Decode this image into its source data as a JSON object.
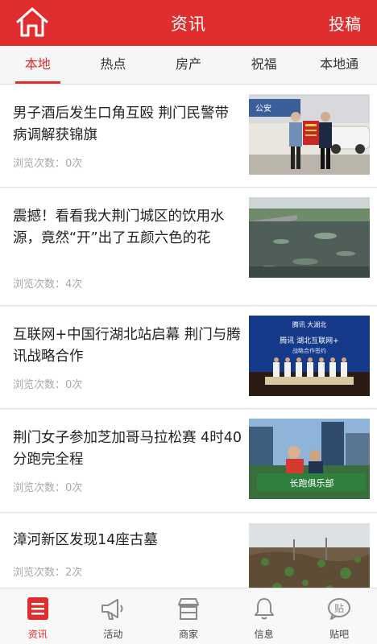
{
  "header": {
    "title": "资讯",
    "post_label": "投稿"
  },
  "tabs": [
    {
      "label": "本地",
      "active": true
    },
    {
      "label": "热点",
      "active": false
    },
    {
      "label": "房产",
      "active": false
    },
    {
      "label": "祝福",
      "active": false
    },
    {
      "label": "本地通",
      "active": false
    }
  ],
  "articles": [
    {
      "title": "男子酒后发生口角互殴 荆门民警带病调解获锦旗",
      "views": "浏览次数：0次"
    },
    {
      "title": "震撼！看看我大荆门城区的饮用水源，竟然“开”出了五颜六色的花",
      "views": "浏览次数：4次"
    },
    {
      "title": "互联网+中国行湖北站启幕 荆门与腾讯战略合作",
      "views": "浏览次数：0次"
    },
    {
      "title": "荆门女子参加芝加哥马拉松赛 4时40分跑完全程",
      "views": "浏览次数：0次"
    },
    {
      "title": "漳河新区发现14座古墓",
      "views": "浏览次数：2次"
    }
  ],
  "thumb_text": {
    "banner_top": "腾讯 大湖北",
    "banner_main": "腾讯 湖北互联网+",
    "banner_sub": "战略合作签约",
    "marathon_banner": "长跑俱乐部",
    "badge": "公安"
  },
  "tabbar": [
    {
      "label": "资讯",
      "icon": "news-icon",
      "active": true
    },
    {
      "label": "活动",
      "icon": "megaphone-icon",
      "active": false
    },
    {
      "label": "商家",
      "icon": "shop-icon",
      "active": false
    },
    {
      "label": "信息",
      "icon": "bell-icon",
      "active": false
    },
    {
      "label": "贴吧",
      "icon": "post-bubble-icon",
      "active": false,
      "glyph": "贴"
    }
  ],
  "colors": {
    "brand": "#e02e2e",
    "text": "#222222",
    "muted": "#a8a8a8",
    "inactive_icon": "#8a8a8a"
  }
}
